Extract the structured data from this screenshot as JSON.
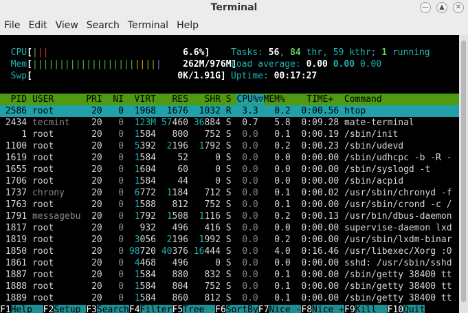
{
  "window": {
    "title": "Terminal"
  },
  "menu": [
    "File",
    "Edit",
    "View",
    "Search",
    "Terminal",
    "Help"
  ],
  "meters": {
    "cpu": {
      "label": "CPU",
      "value": "6.6%"
    },
    "mem": {
      "label": "Mem",
      "value": "262M/976M"
    },
    "swp": {
      "label": "Swp",
      "value": "0K/1.91G"
    }
  },
  "stats": {
    "tasks_label": "Tasks:",
    "tasks": "56",
    "thr": "84",
    "thr_label": "thr,",
    "kthr": "59",
    "kthr_label": "kthr;",
    "running": "1",
    "running_label": "running",
    "load_label": "Load average:",
    "load1": "0.00",
    "load5": "0.00",
    "load15": "0.00",
    "uptime_label": "Uptime:",
    "uptime": "00:17:27"
  },
  "columns": [
    "PID",
    "USER",
    "PRI",
    "NI",
    "VIRT",
    "RES",
    "SHR",
    "S",
    "CPU%",
    "MEM%",
    "TIME+",
    "Command"
  ],
  "processes": [
    {
      "pid": "2586",
      "user": "root",
      "pri": "20",
      "ni": "0",
      "virt": "1968",
      "res": "1676",
      "shr": "1032",
      "s": "R",
      "cpu": "3.3",
      "mem": "0.2",
      "time": "0:00.56",
      "cmd": "htop"
    },
    {
      "pid": "2434",
      "user": "tecmint",
      "pri": "20",
      "ni": "0",
      "virt": "123M",
      "res": "57460",
      "shr": "36884",
      "s": "S",
      "cpu": "0.7",
      "mem": "5.8",
      "time": "0:09.28",
      "cmd": "mate-terminal"
    },
    {
      "pid": "1",
      "user": "root",
      "pri": "20",
      "ni": "0",
      "virt": "1584",
      "res": "800",
      "shr": "752",
      "s": "S",
      "cpu": "0.0",
      "mem": "0.1",
      "time": "0:00.19",
      "cmd": "/sbin/init"
    },
    {
      "pid": "1100",
      "user": "root",
      "pri": "20",
      "ni": "0",
      "virt": "5392",
      "res": "2196",
      "shr": "1792",
      "s": "S",
      "cpu": "0.0",
      "mem": "0.2",
      "time": "0:00.23",
      "cmd": "/sbin/udevd"
    },
    {
      "pid": "1619",
      "user": "root",
      "pri": "20",
      "ni": "0",
      "virt": "1584",
      "res": "52",
      "shr": "0",
      "s": "S",
      "cpu": "0.0",
      "mem": "0.0",
      "time": "0:00.00",
      "cmd": "/sbin/udhcpc -b -R -"
    },
    {
      "pid": "1655",
      "user": "root",
      "pri": "20",
      "ni": "0",
      "virt": "1604",
      "res": "60",
      "shr": "0",
      "s": "S",
      "cpu": "0.0",
      "mem": "0.0",
      "time": "0:00.00",
      "cmd": "/sbin/syslogd -t"
    },
    {
      "pid": "1706",
      "user": "root",
      "pri": "20",
      "ni": "0",
      "virt": "1584",
      "res": "44",
      "shr": "0",
      "s": "S",
      "cpu": "0.0",
      "mem": "0.0",
      "time": "0:00.00",
      "cmd": "/sbin/acpid"
    },
    {
      "pid": "1737",
      "user": "chrony",
      "pri": "20",
      "ni": "0",
      "virt": "6772",
      "res": "1184",
      "shr": "712",
      "s": "S",
      "cpu": "0.0",
      "mem": "0.1",
      "time": "0:00.02",
      "cmd": "/usr/sbin/chronyd -f"
    },
    {
      "pid": "1763",
      "user": "root",
      "pri": "20",
      "ni": "0",
      "virt": "1588",
      "res": "812",
      "shr": "752",
      "s": "S",
      "cpu": "0.0",
      "mem": "0.1",
      "time": "0:00.00",
      "cmd": "/usr/sbin/crond -c /"
    },
    {
      "pid": "1791",
      "user": "messagebu",
      "pri": "20",
      "ni": "0",
      "virt": "1792",
      "res": "1508",
      "shr": "1116",
      "s": "S",
      "cpu": "0.0",
      "mem": "0.2",
      "time": "0:00.13",
      "cmd": "/usr/bin/dbus-daemon"
    },
    {
      "pid": "1817",
      "user": "root",
      "pri": "20",
      "ni": "0",
      "virt": "932",
      "res": "496",
      "shr": "416",
      "s": "S",
      "cpu": "0.0",
      "mem": "0.0",
      "time": "0:00.00",
      "cmd": "supervise-daemon lxd"
    },
    {
      "pid": "1819",
      "user": "root",
      "pri": "20",
      "ni": "0",
      "virt": "3056",
      "res": "2196",
      "shr": "1992",
      "s": "S",
      "cpu": "0.0",
      "mem": "0.2",
      "time": "0:00.00",
      "cmd": "/usr/sbin/lxdm-binar"
    },
    {
      "pid": "1850",
      "user": "root",
      "pri": "20",
      "ni": "0",
      "virt": "98720",
      "res": "40376",
      "shr": "16444",
      "s": "S",
      "cpu": "0.0",
      "mem": "4.0",
      "time": "0:16.46",
      "cmd": "/usr/libexec/Xorg :0"
    },
    {
      "pid": "1861",
      "user": "root",
      "pri": "20",
      "ni": "0",
      "virt": "4468",
      "res": "496",
      "shr": "0",
      "s": "S",
      "cpu": "0.0",
      "mem": "0.0",
      "time": "0:00.00",
      "cmd": "sshd: /usr/sbin/sshd"
    },
    {
      "pid": "1887",
      "user": "root",
      "pri": "20",
      "ni": "0",
      "virt": "1584",
      "res": "880",
      "shr": "832",
      "s": "S",
      "cpu": "0.0",
      "mem": "0.1",
      "time": "0:00.00",
      "cmd": "/sbin/getty 38400 tt"
    },
    {
      "pid": "1888",
      "user": "root",
      "pri": "20",
      "ni": "0",
      "virt": "1584",
      "res": "804",
      "shr": "752",
      "s": "S",
      "cpu": "0.0",
      "mem": "0.1",
      "time": "0:00.00",
      "cmd": "/sbin/getty 38400 tt"
    },
    {
      "pid": "1889",
      "user": "root",
      "pri": "20",
      "ni": "0",
      "virt": "1584",
      "res": "860",
      "shr": "812",
      "s": "S",
      "cpu": "0.0",
      "mem": "0.1",
      "time": "0:00.00",
      "cmd": "/sbin/getty 38400 tt"
    }
  ],
  "fkeys": [
    {
      "key": "F1",
      "label": "Help  "
    },
    {
      "key": "F2",
      "label": "Setup "
    },
    {
      "key": "F3",
      "label": "Search"
    },
    {
      "key": "F4",
      "label": "Filter"
    },
    {
      "key": "F5",
      "label": "Tree  "
    },
    {
      "key": "F6",
      "label": "SortBy"
    },
    {
      "key": "F7",
      "label": "Nice -"
    },
    {
      "key": "F8",
      "label": "Nice +"
    },
    {
      "key": "F9",
      "label": "Kill  "
    },
    {
      "key": "F10",
      "label": "Quit"
    }
  ]
}
